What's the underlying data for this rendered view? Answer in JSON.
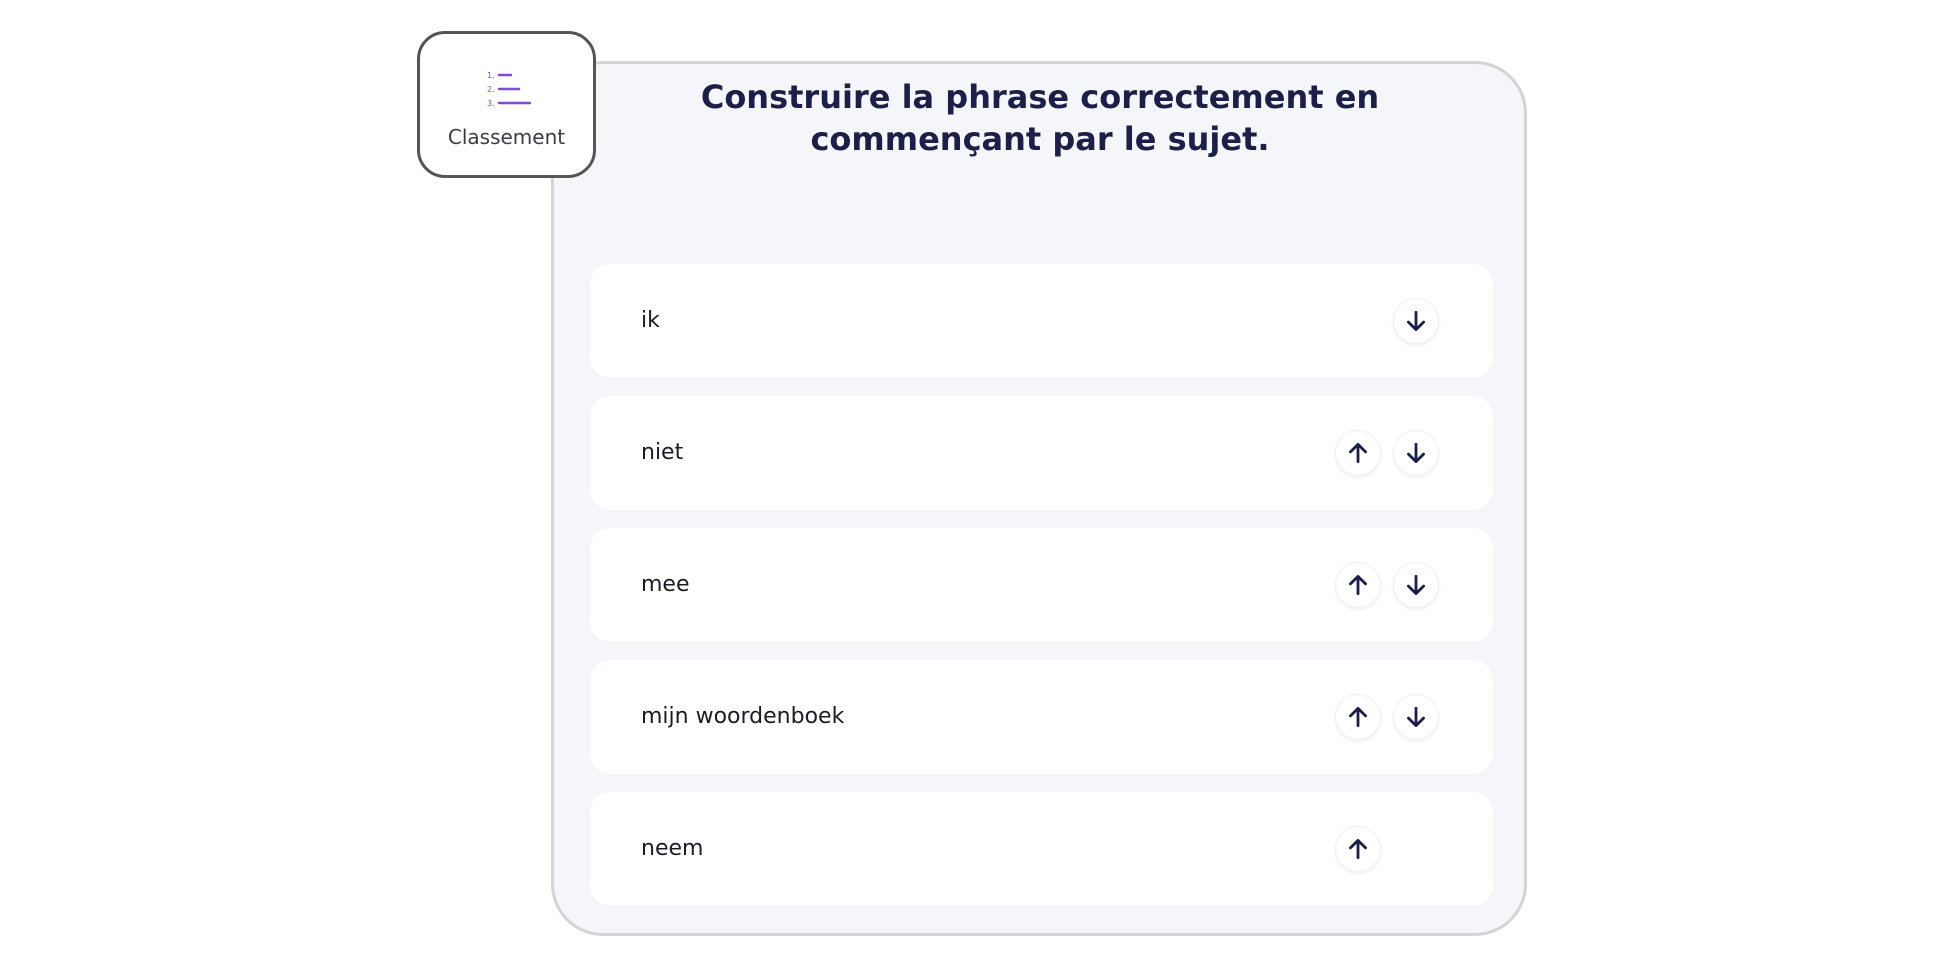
{
  "activity": {
    "label": "Classement",
    "icon": "ordered-list-icon",
    "accent_color": "#7a4fd1"
  },
  "question": {
    "title": "Construire la phrase correctement en commençant par le sujet."
  },
  "items": [
    {
      "text": "ik",
      "can_move_up": false,
      "can_move_down": true
    },
    {
      "text": "niet",
      "can_move_up": true,
      "can_move_down": true
    },
    {
      "text": "mee",
      "can_move_up": true,
      "can_move_down": true
    },
    {
      "text": "mijn woordenboek",
      "can_move_up": true,
      "can_move_down": true
    },
    {
      "text": "neem",
      "can_move_up": true,
      "can_move_down": false
    }
  ],
  "colors": {
    "title": "#1c1f4a",
    "arrow": "#1c1f4a",
    "card_background": "#f5f6f9",
    "card_border": "#d3d4d8"
  }
}
